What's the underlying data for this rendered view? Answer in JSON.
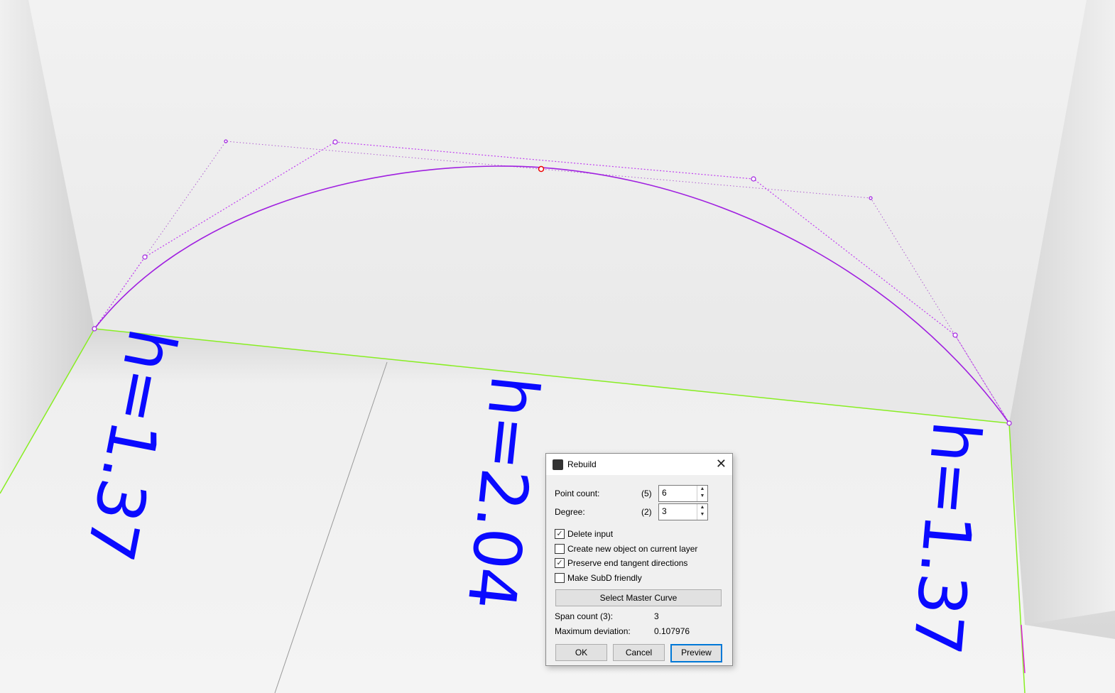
{
  "viewport": {
    "labels": [
      "h=1.37",
      "h=2.04",
      "h=1.37"
    ],
    "colors": {
      "curve": "#a020e0",
      "edge": "#88ee22",
      "label": "#0a0aff"
    }
  },
  "dialog": {
    "title": "Rebuild",
    "point_count_label": "Point count:",
    "point_count_prev": "(5)",
    "point_count_value": "6",
    "degree_label": "Degree:",
    "degree_prev": "(2)",
    "degree_value": "3",
    "options": [
      {
        "label": "Delete input",
        "checked": true
      },
      {
        "label": "Create new object on current layer",
        "checked": false
      },
      {
        "label": "Preserve end tangent directions",
        "checked": true
      },
      {
        "label": "Make SubD friendly",
        "checked": false
      }
    ],
    "select_master_label": "Select Master Curve",
    "span_count_label": "Span count (3):",
    "span_count_value": "3",
    "max_dev_label": "Maximum deviation:",
    "max_dev_value": "0.107976",
    "ok_label": "OK",
    "cancel_label": "Cancel",
    "preview_label": "Preview"
  }
}
